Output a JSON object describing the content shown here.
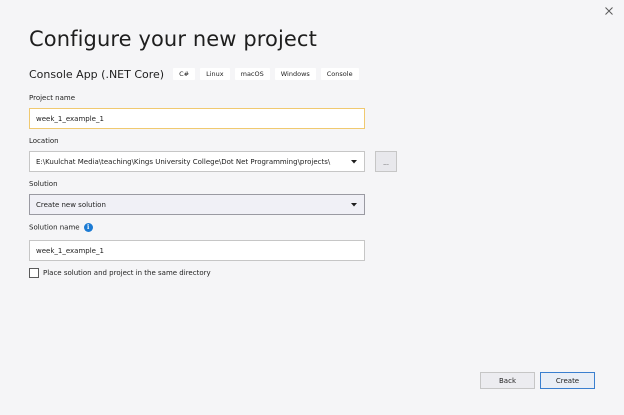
{
  "window": {
    "close_glyph": "✕"
  },
  "header": {
    "title": "Configure your new project",
    "template_name": "Console App (.NET Core)",
    "tags": [
      "C#",
      "Linux",
      "macOS",
      "Windows",
      "Console"
    ]
  },
  "form": {
    "project_name": {
      "label": "Project name",
      "value": "week_1_example_1"
    },
    "location": {
      "label": "Location",
      "value": "E:\\Kuulchat Media\\teaching\\Kings University College\\Dot Net Programming\\projects\\",
      "browse_label": "..."
    },
    "solution": {
      "label": "Solution",
      "selected": "Create new solution"
    },
    "solution_name": {
      "label": "Solution name",
      "info_glyph": "i",
      "value": "week_1_example_1"
    },
    "same_directory": {
      "label": "Place solution and project in the same directory",
      "checked": false
    }
  },
  "footer": {
    "back_label": "Back",
    "create_label": "Create"
  },
  "colors": {
    "background": "#f5f5f7",
    "focus_border": "#f0c970",
    "info_icon": "#1c7bd4",
    "primary_border": "#3a7fcf"
  }
}
